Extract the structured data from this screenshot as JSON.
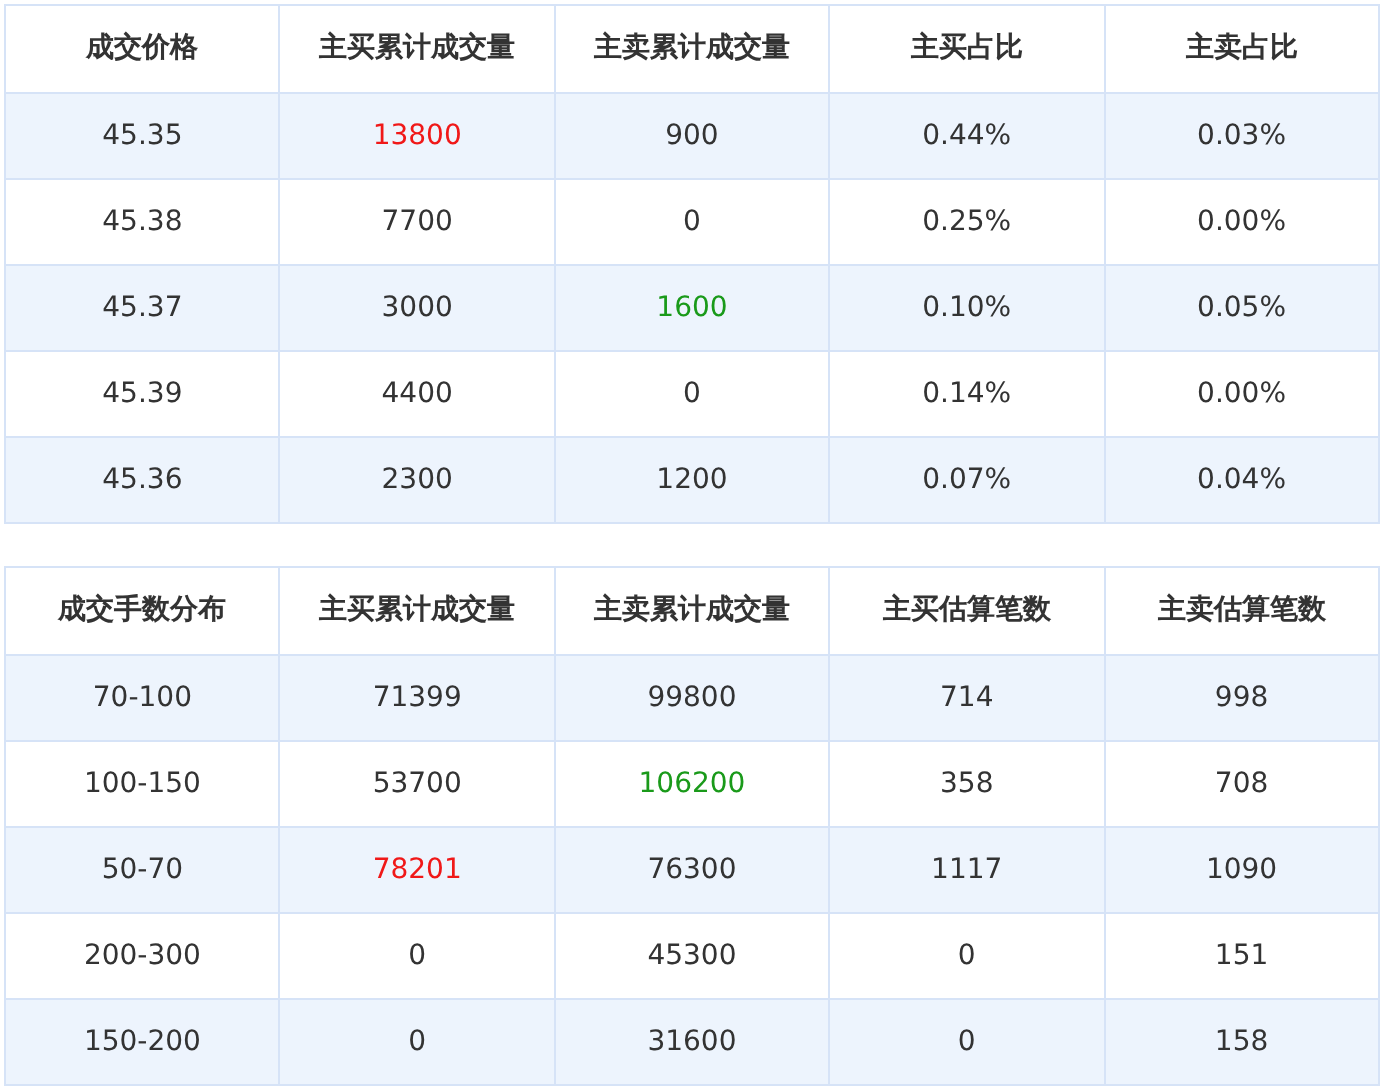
{
  "tables": [
    {
      "columns": [
        "成交价格",
        "主买累计成交量",
        "主卖累计成交量",
        "主买占比",
        "主卖占比"
      ],
      "rows": [
        [
          {
            "text": "45.35"
          },
          {
            "text": "13800",
            "color": "#f01818"
          },
          {
            "text": "900"
          },
          {
            "text": "0.44%"
          },
          {
            "text": "0.03%"
          }
        ],
        [
          {
            "text": "45.38"
          },
          {
            "text": "7700"
          },
          {
            "text": "0"
          },
          {
            "text": "0.25%"
          },
          {
            "text": "0.00%"
          }
        ],
        [
          {
            "text": "45.37"
          },
          {
            "text": "3000"
          },
          {
            "text": "1600",
            "color": "#1a9a1a"
          },
          {
            "text": "0.10%"
          },
          {
            "text": "0.05%"
          }
        ],
        [
          {
            "text": "45.39"
          },
          {
            "text": "4400"
          },
          {
            "text": "0"
          },
          {
            "text": "0.14%"
          },
          {
            "text": "0.00%"
          }
        ],
        [
          {
            "text": "45.36"
          },
          {
            "text": "2300"
          },
          {
            "text": "1200"
          },
          {
            "text": "0.07%"
          },
          {
            "text": "0.04%"
          }
        ]
      ]
    },
    {
      "columns": [
        "成交手数分布",
        "主买累计成交量",
        "主卖累计成交量",
        "主买估算笔数",
        "主卖估算笔数"
      ],
      "rows": [
        [
          {
            "text": "70-100"
          },
          {
            "text": "71399"
          },
          {
            "text": "99800"
          },
          {
            "text": "714"
          },
          {
            "text": "998"
          }
        ],
        [
          {
            "text": "100-150"
          },
          {
            "text": "53700"
          },
          {
            "text": "106200",
            "color": "#1a9a1a"
          },
          {
            "text": "358"
          },
          {
            "text": "708"
          }
        ],
        [
          {
            "text": "50-70"
          },
          {
            "text": "78201",
            "color": "#f01818"
          },
          {
            "text": "76300"
          },
          {
            "text": "1117"
          },
          {
            "text": "1090"
          }
        ],
        [
          {
            "text": "200-300"
          },
          {
            "text": "0"
          },
          {
            "text": "45300"
          },
          {
            "text": "0"
          },
          {
            "text": "151"
          }
        ],
        [
          {
            "text": "150-200"
          },
          {
            "text": "0"
          },
          {
            "text": "31600"
          },
          {
            "text": "0"
          },
          {
            "text": "158"
          }
        ]
      ]
    }
  ]
}
